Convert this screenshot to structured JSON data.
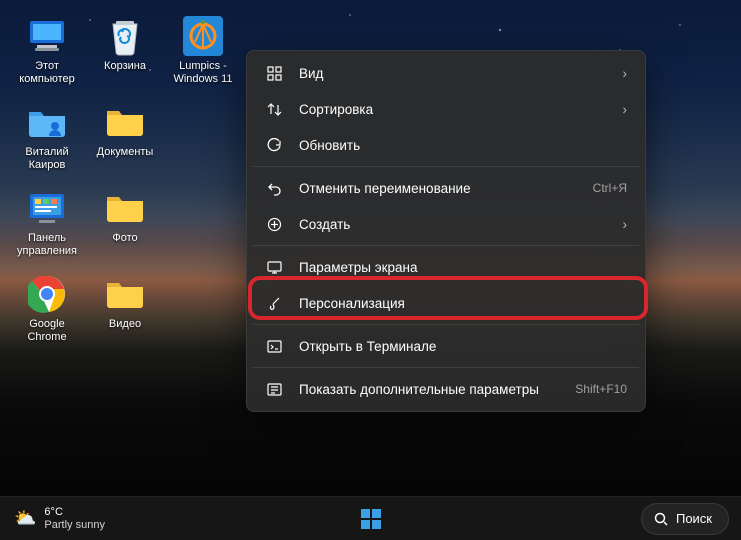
{
  "desktop_icons": [
    {
      "name": "this-pc",
      "label": "Этот\nкомпьютер"
    },
    {
      "name": "recycle-bin",
      "label": "Корзина"
    },
    {
      "name": "lumpics",
      "label": "Lumpics -\nWindows 11"
    },
    {
      "name": "user-folder",
      "label": "Виталий\nКаиров"
    },
    {
      "name": "documents-folder",
      "label": "Документы"
    },
    {
      "name": "control-panel",
      "label": "Панель\nуправления"
    },
    {
      "name": "photo-folder",
      "label": "Фото"
    },
    {
      "name": "chrome",
      "label": "Google\nChrome"
    },
    {
      "name": "video-folder",
      "label": "Видео"
    }
  ],
  "context_menu": {
    "items": [
      {
        "icon": "grid",
        "label": "Вид",
        "sub": true
      },
      {
        "icon": "sort",
        "label": "Сортировка",
        "sub": true
      },
      {
        "icon": "refresh",
        "label": "Обновить"
      }
    ],
    "items2": [
      {
        "icon": "undo",
        "label": "Отменить переименование",
        "kbd": "Ctrl+Я"
      },
      {
        "icon": "plus",
        "label": "Создать",
        "sub": true
      }
    ],
    "items3": [
      {
        "icon": "display",
        "label": "Параметры экрана"
      },
      {
        "icon": "brush",
        "label": "Персонализация",
        "highlight": true
      }
    ],
    "items4": [
      {
        "icon": "terminal",
        "label": "Открыть в Терминале"
      }
    ],
    "items5": [
      {
        "icon": "more",
        "label": "Показать дополнительные параметры",
        "kbd": "Shift+F10"
      }
    ]
  },
  "taskbar": {
    "temp": "6°C",
    "condition": "Partly sunny",
    "search": "Поиск"
  }
}
